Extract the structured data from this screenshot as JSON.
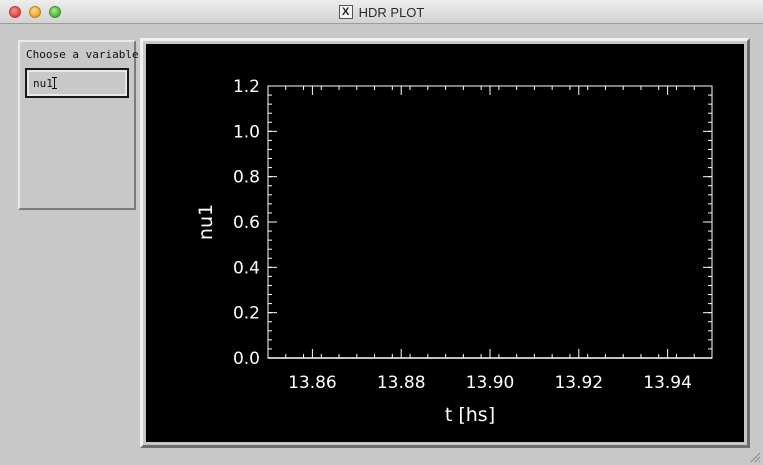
{
  "window": {
    "title": "HDR PLOT",
    "title_icon": "x11-icon",
    "title_icon_glyph": "X"
  },
  "controls": {
    "choose_label": "Choose a variable",
    "variable_value": "nu1"
  },
  "chart_data": {
    "type": "line",
    "title": "",
    "xlabel": "t [hs]",
    "ylabel": "nu1",
    "xlim": [
      13.85,
      13.95
    ],
    "ylim": [
      0.0,
      1.2
    ],
    "x_ticks": [
      13.86,
      13.88,
      13.9,
      13.92,
      13.94
    ],
    "x_tick_labels": [
      "13.86",
      "13.88",
      "13.90",
      "13.92",
      "13.94"
    ],
    "y_ticks": [
      0.0,
      0.2,
      0.4,
      0.6,
      0.8,
      1.0,
      1.2
    ],
    "y_tick_labels": [
      "0.0",
      "0.2",
      "0.4",
      "0.6",
      "0.8",
      "1.0",
      "1.2"
    ],
    "series": [
      {
        "x": [
          13.85,
          13.95
        ],
        "y": [
          0.0,
          0.0
        ]
      }
    ],
    "grid": false,
    "colors": {
      "background": "#000000",
      "foreground": "#ffffff"
    }
  }
}
